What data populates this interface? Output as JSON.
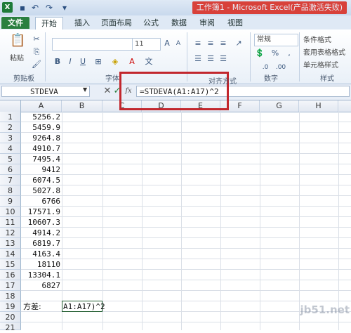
{
  "titlebar": {
    "app_icon": "X",
    "title": "工作簿1 - Microsoft Excel(产品激活失败)",
    "quick_access": [
      "save-icon",
      "undo-icon",
      "redo-icon",
      "customize-icon"
    ]
  },
  "tabs": [
    "文件",
    "开始",
    "插入",
    "页面布局",
    "公式",
    "数据",
    "审阅",
    "视图"
  ],
  "ribbon": {
    "clipboard_label": "剪贴板",
    "paste_label": "粘贴",
    "font_label": "字体",
    "font_size": "11",
    "align_label": "对齐方式",
    "number_label": "数字",
    "number_format": "常规",
    "styles_label": "样式",
    "style_items": [
      "条件格式",
      "套用表格格式",
      "单元格样式"
    ]
  },
  "formula_bar": {
    "name_box": "STDEVA",
    "fx": "fx",
    "formula": "=STDEVA(A1:A17)^2"
  },
  "grid": {
    "columns": [
      "A",
      "B",
      "C",
      "D",
      "E",
      "F",
      "G",
      "H"
    ],
    "rows": [
      "1",
      "2",
      "3",
      "4",
      "5",
      "6",
      "7",
      "8",
      "9",
      "10",
      "11",
      "12",
      "13",
      "14",
      "15",
      "16",
      "17",
      "18",
      "19",
      "20",
      "21",
      "22"
    ],
    "col_a_values": [
      "5256.2",
      "5459.9",
      "9264.8",
      "4910.7",
      "7495.4",
      "9412",
      "6074.5",
      "5027.8",
      "6766",
      "17571.9",
      "10607.3",
      "4914.2",
      "6819.7",
      "4163.4",
      "18110",
      "13304.1",
      "6827"
    ],
    "a19_label": "方差:",
    "b19_edit": "A1:A17)^2"
  },
  "watermark": "jb51.net"
}
